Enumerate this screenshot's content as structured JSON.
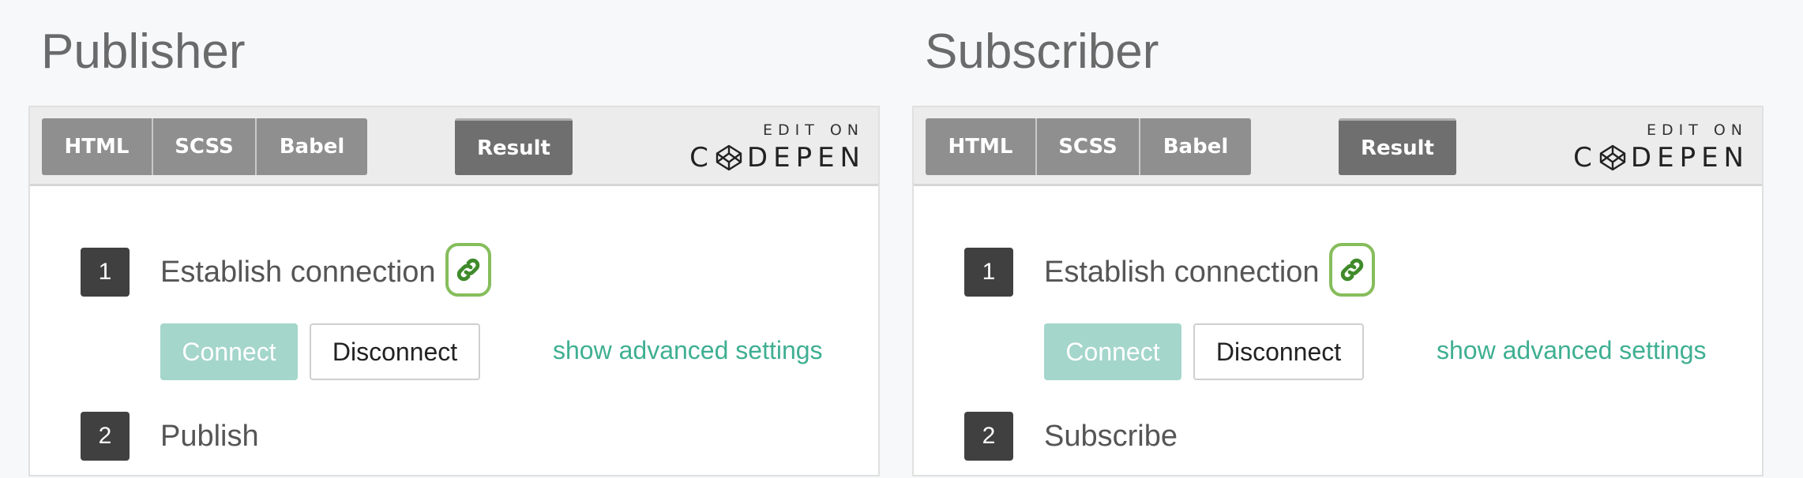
{
  "panels": [
    {
      "title": "Publisher",
      "tabs": {
        "html": "HTML",
        "scss": "SCSS",
        "babel": "Babel",
        "result": "Result"
      },
      "codepen": {
        "edit_on": "EDIT ON",
        "brand_left": "C",
        "brand_right": "DEPEN"
      },
      "steps": [
        {
          "number": "1",
          "label": "Establish connection"
        },
        {
          "number": "2",
          "label": "Publish"
        }
      ],
      "buttons": {
        "connect": "Connect",
        "disconnect": "Disconnect"
      },
      "advanced_link": "show advanced settings"
    },
    {
      "title": "Subscriber",
      "tabs": {
        "html": "HTML",
        "scss": "SCSS",
        "babel": "Babel",
        "result": "Result"
      },
      "codepen": {
        "edit_on": "EDIT ON",
        "brand_left": "C",
        "brand_right": "DEPEN"
      },
      "steps": [
        {
          "number": "1",
          "label": "Establish connection"
        },
        {
          "number": "2",
          "label": "Subscribe"
        }
      ],
      "buttons": {
        "connect": "Connect",
        "disconnect": "Disconnect"
      },
      "advanced_link": "show advanced settings"
    }
  ],
  "icons": {
    "link": "link-icon",
    "codepen_logo": "codepen-logo-icon"
  },
  "colors": {
    "connect_button_bg": "#a4d6cb",
    "advanced_link": "#3faf92",
    "link_badge_border": "#86bd5c",
    "link_icon": "#3f8a2a",
    "step_number_bg": "#404040"
  }
}
